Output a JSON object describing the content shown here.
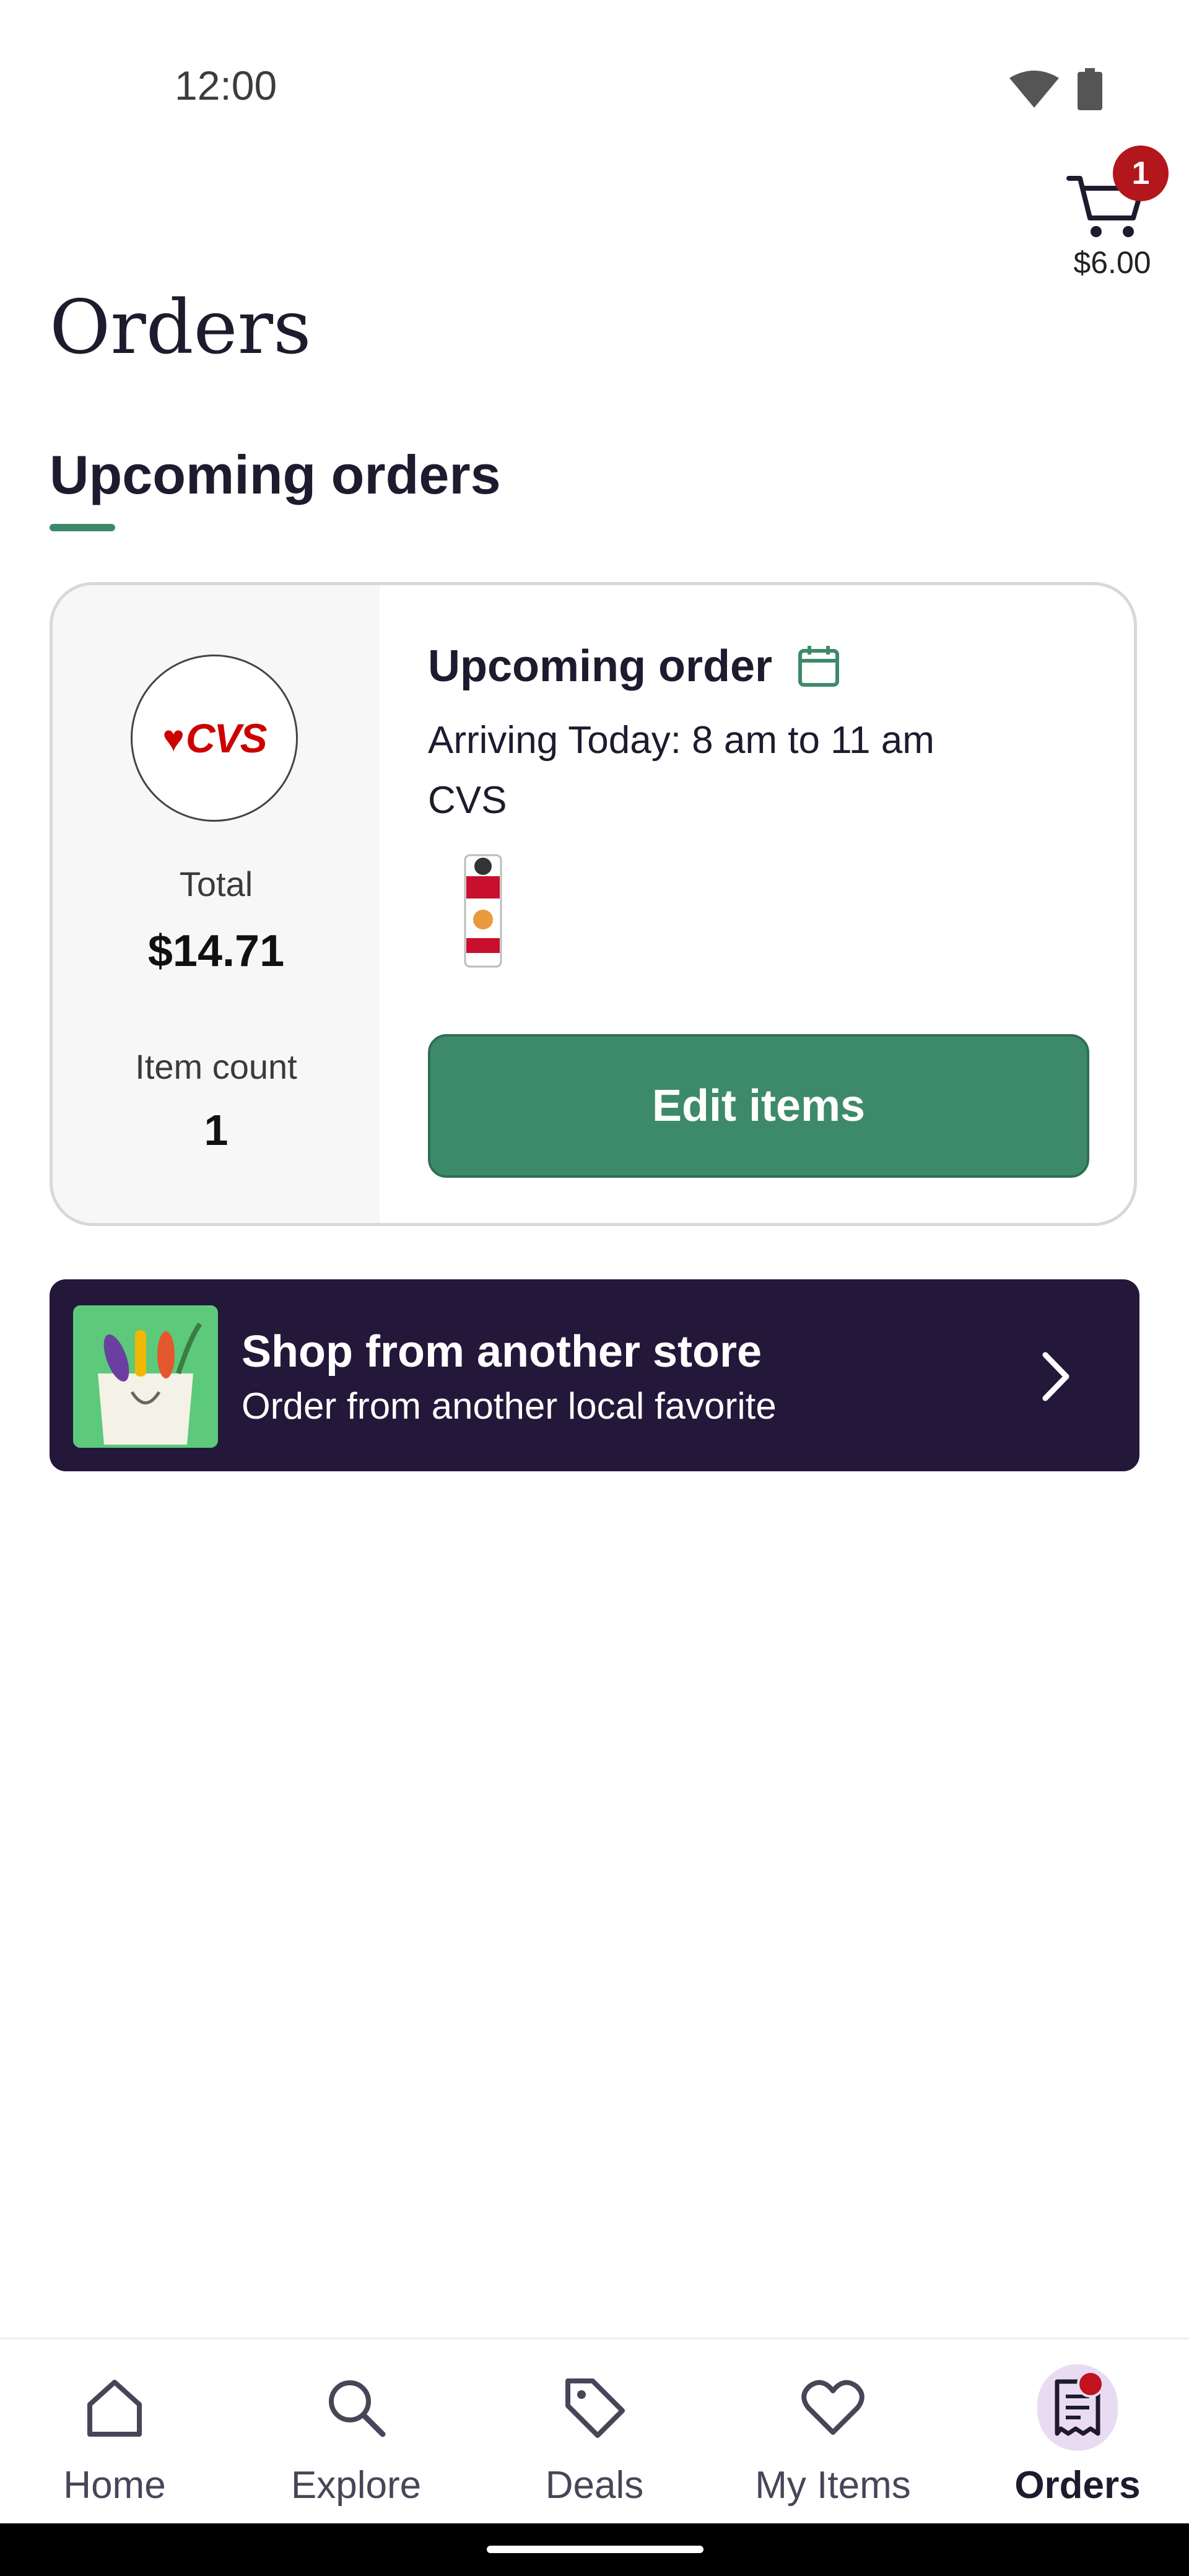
{
  "status_bar": {
    "time": "12:00",
    "wifi_icon": "wifi-icon",
    "battery_icon": "battery-icon"
  },
  "cart": {
    "badge_count": "1",
    "total": "$6.00",
    "icon": "cart-icon"
  },
  "page": {
    "title": "Orders",
    "section_tab": "Upcoming orders"
  },
  "order": {
    "heading": "Upcoming order",
    "calendar_icon": "calendar-icon",
    "arrival": "Arriving Today: 8 am to 11 am",
    "store": "CVS",
    "logo_text": "CVS",
    "total_label": "Total",
    "total_value": "$14.71",
    "item_count_label": "Item count",
    "item_count_value": "1",
    "edit_button": "Edit items"
  },
  "promo": {
    "title": "Shop from another store",
    "subtitle": "Order from another local favorite"
  },
  "bottom_nav": {
    "items": [
      {
        "label": "Home",
        "icon": "home-icon"
      },
      {
        "label": "Explore",
        "icon": "search-icon"
      },
      {
        "label": "Deals",
        "icon": "tag-icon"
      },
      {
        "label": "My Items",
        "icon": "heart-icon"
      },
      {
        "label": "Orders",
        "icon": "receipt-icon",
        "active": true
      }
    ]
  },
  "colors": {
    "accent": "#3d8a6a",
    "promo_bg": "#23173a",
    "badge": "#b3161b"
  }
}
